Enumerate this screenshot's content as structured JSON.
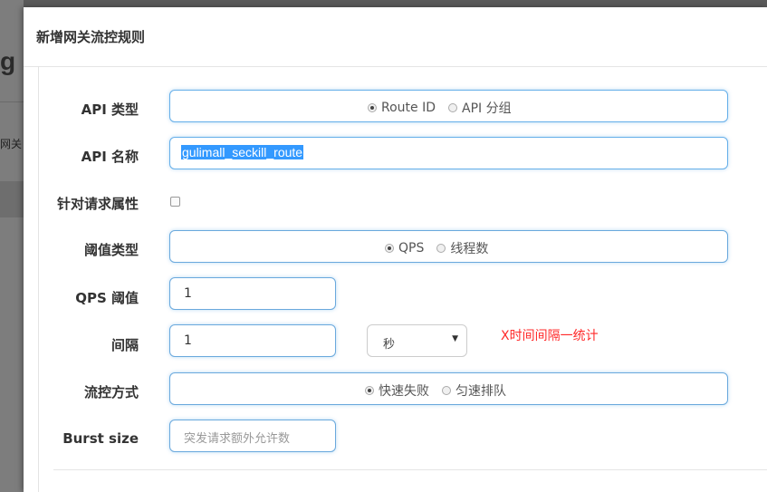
{
  "background": {
    "partial_title": "g",
    "partial_text": "网关"
  },
  "modal": {
    "title": "新增网关流控规则"
  },
  "form": {
    "api_type": {
      "label": "API 类型",
      "options": [
        {
          "label": "Route ID",
          "selected": true
        },
        {
          "label": "API 分组",
          "selected": false
        }
      ]
    },
    "api_name": {
      "label": "API 名称",
      "value": "gulimall_seckill_route"
    },
    "request_attr": {
      "label": "针对请求属性",
      "checked": false
    },
    "threshold_type": {
      "label": "阈值类型",
      "options": [
        {
          "label": "QPS",
          "selected": true
        },
        {
          "label": "线程数",
          "selected": false
        }
      ]
    },
    "qps_threshold": {
      "label": "QPS 阈值",
      "value": "1"
    },
    "interval": {
      "label": "间隔",
      "value": "1",
      "unit": "秒"
    },
    "annotation": "X时间间隔一统计",
    "control_mode": {
      "label": "流控方式",
      "options": [
        {
          "label": "快速失败",
          "selected": true
        },
        {
          "label": "匀速排队",
          "selected": false
        }
      ]
    },
    "burst_size": {
      "label": "Burst size",
      "placeholder": "突发请求额外允许数"
    }
  },
  "colors": {
    "focus_border": "#66afe9",
    "selection": "#3399ff",
    "annotation": "#ff2a2a"
  }
}
